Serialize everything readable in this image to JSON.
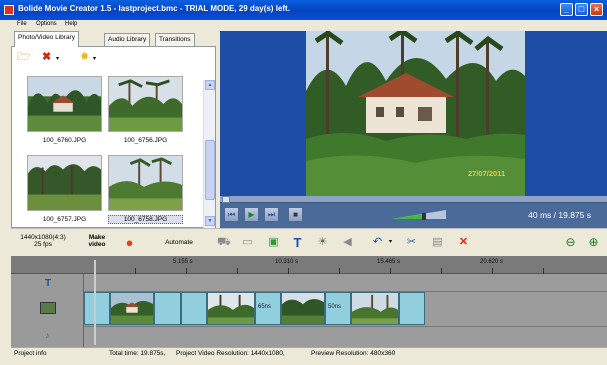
{
  "window": {
    "title": "Bolide Movie Creator 1.5 - lastproject.bmc - TRIAL MODE, 29 day(s) left."
  },
  "menu": [
    "File",
    "Options",
    "Help"
  ],
  "library": {
    "tabs": [
      "Photo/Video Library",
      "Audio Library",
      "Transitions"
    ],
    "items": [
      {
        "name": "100_6760.JPG"
      },
      {
        "name": "100_6756.JPG"
      },
      {
        "name": "100_6757.JPG"
      },
      {
        "name": "100_6758.JPG"
      }
    ]
  },
  "preview": {
    "datestamp": "27/07/2011",
    "time_readout": "40 ms  / 19.875 s"
  },
  "toolbar": {
    "resolution": "1440x1080(4:3)",
    "fps": "25 fps",
    "make_video": "Make video",
    "automate": "Automate"
  },
  "timeline": {
    "ruler_labels": [
      "5.155 s",
      "10.310 s",
      "15.465 s",
      "20.620 s"
    ],
    "transition_labels": [
      "65ns",
      "50ns"
    ]
  },
  "status": {
    "project_info": "Project info",
    "total_time": "Total time: 19.875s,",
    "project_resolution": "Project Video Resolution:  1440x1080,",
    "preview_resolution": "Preview Resolution:  480x360"
  },
  "colors": {
    "title_bar": "#0543c0",
    "preview_bg": "#1e4da5",
    "timeline_clip": "#92cfde",
    "datestamp": "#f0c93a"
  }
}
